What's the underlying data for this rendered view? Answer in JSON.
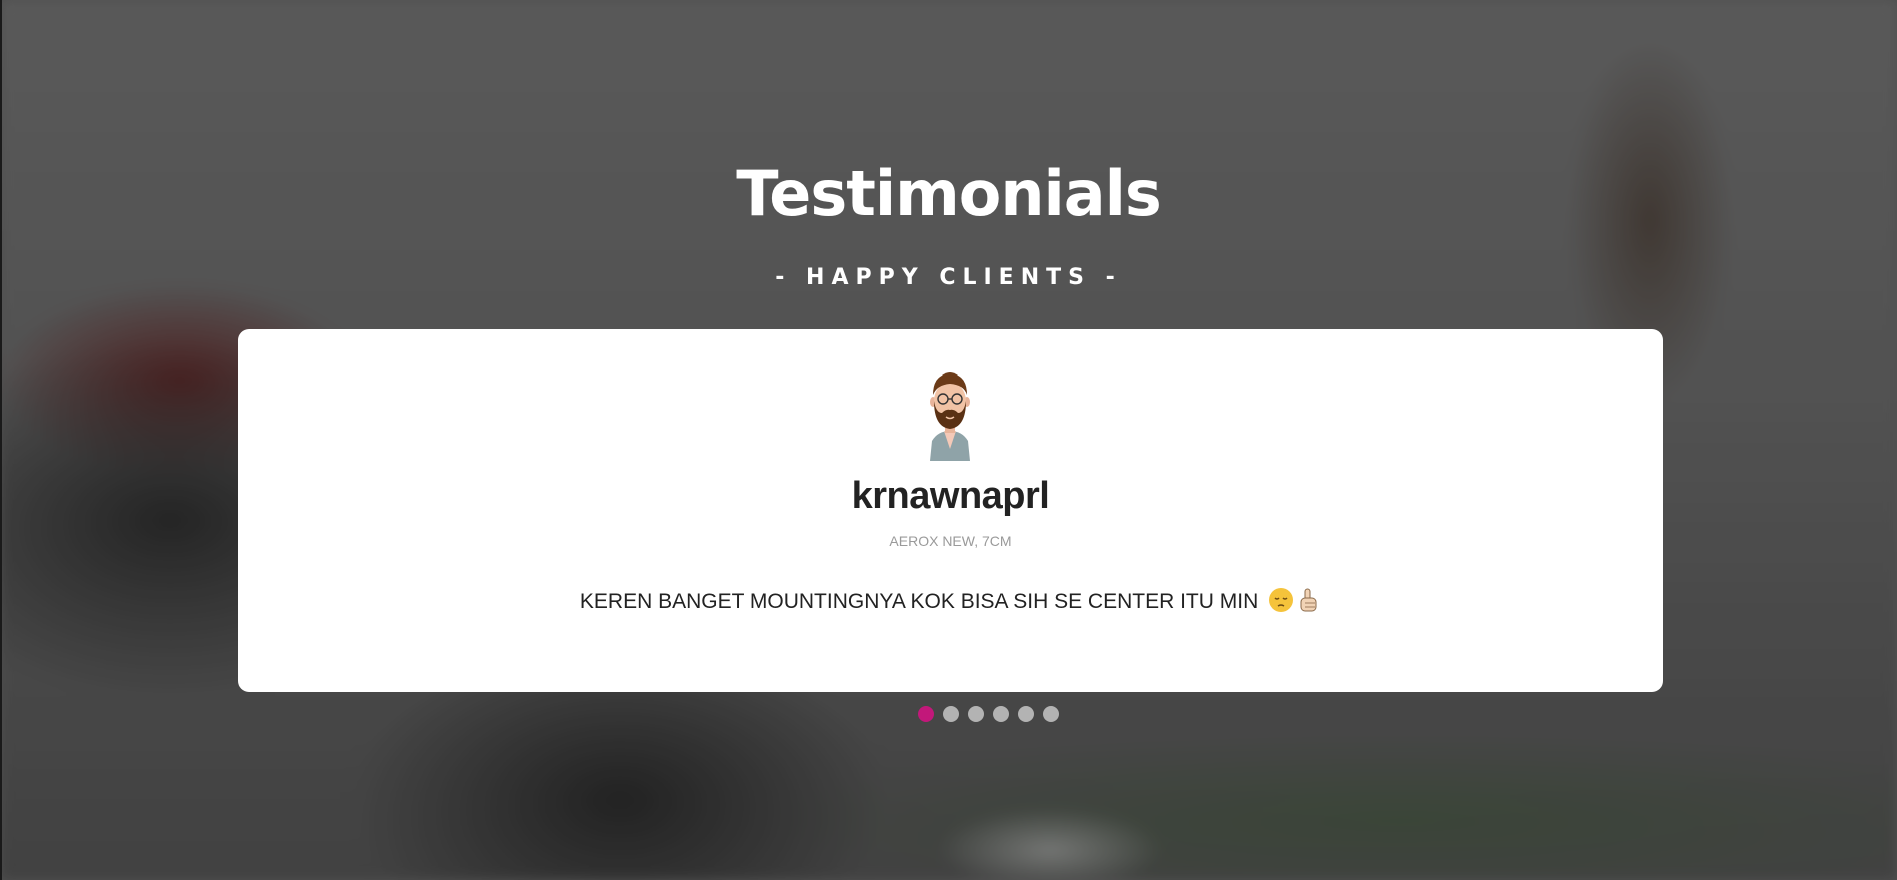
{
  "section": {
    "title": "Testimonials",
    "subtitle": "- HAPPY CLIENTS -"
  },
  "testimonial": {
    "avatar_icon": "bearded-man-avatar-icon",
    "name": "krnawnaprl",
    "product": "AEROX NEW, 7CM",
    "quote_text": "KEREN BANGET MOUNTINGNYA KOK BISA SIH SE CENTER ITU MIN",
    "quote_emojis": [
      "pensive-face-icon",
      "index-pointing-up-icon"
    ]
  },
  "carousel": {
    "total_slides": 6,
    "active_index": 0,
    "active_color": "#c2187a",
    "inactive_color": "#b3b3b3"
  },
  "colors": {
    "card_background": "#ffffff",
    "title_color": "#ffffff"
  }
}
